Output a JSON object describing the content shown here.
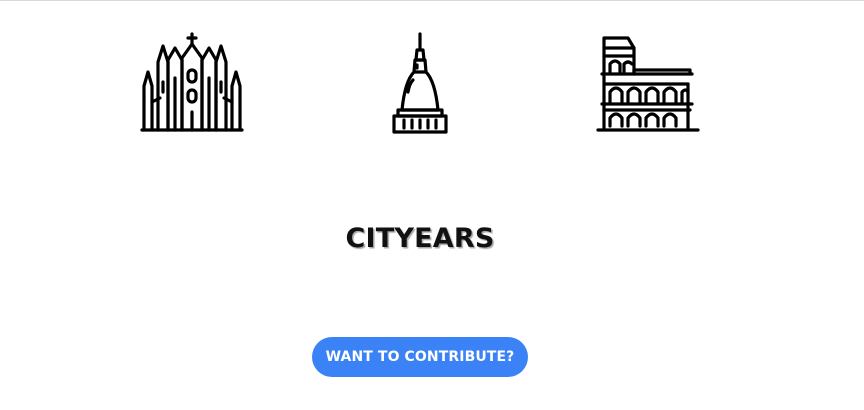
{
  "header": {
    "icons": [
      {
        "name": "milan-cathedral-icon",
        "subject": "Duomo di Milano"
      },
      {
        "name": "mole-antonelliana-icon",
        "subject": "Mole Antonelliana"
      },
      {
        "name": "colosseum-icon",
        "subject": "Colosseum"
      }
    ]
  },
  "main": {
    "title": "CITYEARS",
    "contribute_label": "WANT TO CONTRIBUTE?"
  },
  "colors": {
    "accent": "#3b82f6",
    "icon_stroke": "#000000",
    "title_text": "#111111",
    "background": "#ffffff"
  }
}
